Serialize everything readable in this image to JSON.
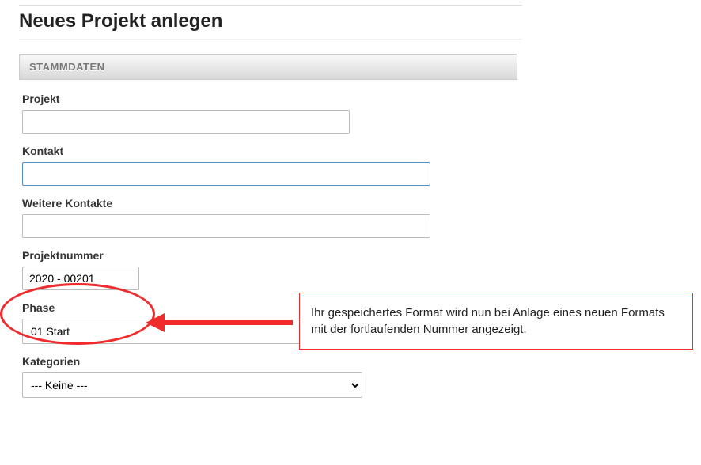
{
  "pageTitle": "Neues Projekt anlegen",
  "panelHeader": "STAMMDATEN",
  "fields": {
    "projekt": {
      "label": "Projekt",
      "value": ""
    },
    "kontakt": {
      "label": "Kontakt",
      "value": ""
    },
    "weitereKontakte": {
      "label": "Weitere Kontakte",
      "value": ""
    },
    "projektnummer": {
      "label": "Projektnummer",
      "value": "2020 - 00201"
    },
    "phase": {
      "label": "Phase",
      "selected": "01 Start"
    },
    "kategorien": {
      "label": "Kategorien",
      "selected": "--- Keine ---"
    }
  },
  "annotation": {
    "text": "Ihr gespeichertes Format wird nun bei Anlage eines neuen Formats mit der fortlaufenden Nummer angezeigt."
  }
}
